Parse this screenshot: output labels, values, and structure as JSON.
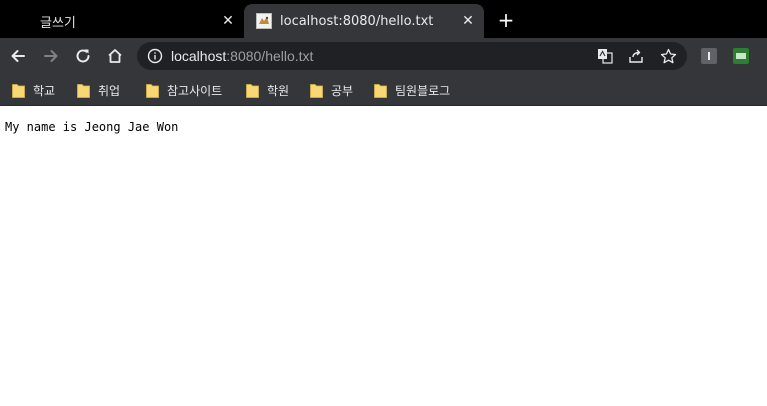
{
  "tabs": [
    {
      "title": "글쓰기",
      "close": "✕"
    },
    {
      "title": "localhost:8080/hello.txt",
      "close": "✕"
    }
  ],
  "new_tab": "+",
  "address": {
    "host": "localhost",
    "rest": ":8080/hello.txt"
  },
  "icons": {
    "back": "arrow-left-icon",
    "forward": "arrow-right-icon",
    "reload": "reload-icon",
    "home": "home-icon",
    "info": "info-icon",
    "translate": "translate-icon",
    "share": "share-icon",
    "bookmark": "star-icon"
  },
  "bookmarks": [
    "학교",
    "취업",
    "참고사이트",
    "학원",
    "공부",
    "팀원블로그"
  ],
  "page": {
    "text": "My name is Jeong Jae Won"
  },
  "colors": {
    "tabstrip": "#000000",
    "toolbar": "#35363a",
    "omnibox": "#202124",
    "folder": "#f8d775"
  }
}
